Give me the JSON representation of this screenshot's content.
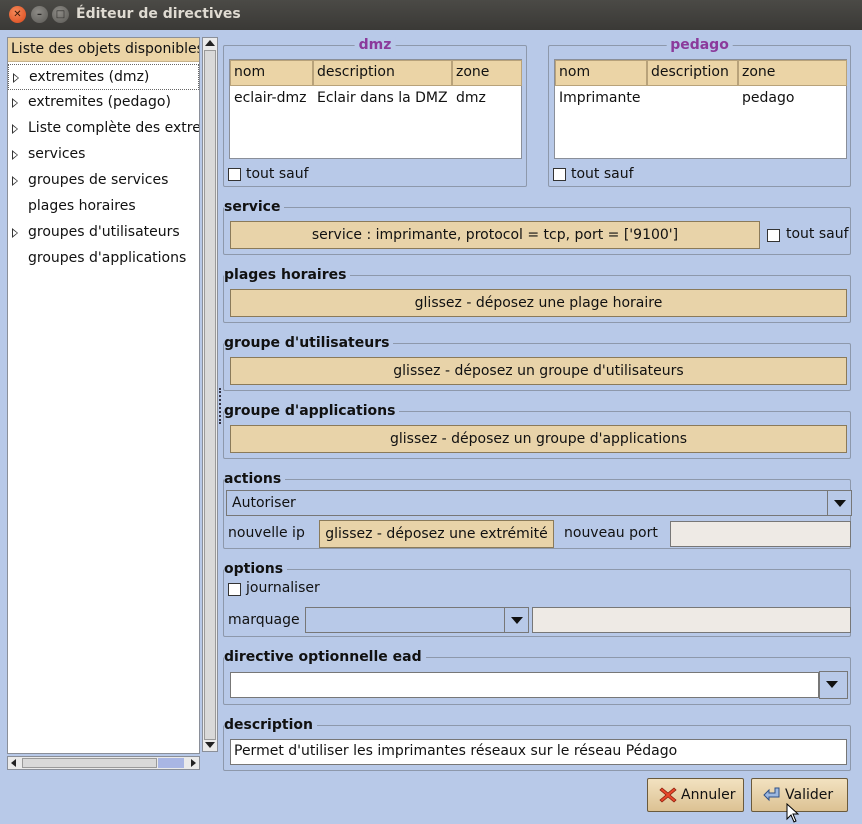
{
  "window": {
    "title": "Éditeur de directives",
    "close_glyph": "✕",
    "min_glyph": "–",
    "max_glyph": "□"
  },
  "left_panel": {
    "header": "Liste des objets disponibles",
    "items": [
      {
        "label": "extremites (dmz)",
        "expandable": true
      },
      {
        "label": "extremites (pedago)",
        "expandable": true
      },
      {
        "label": "Liste complète des extremites",
        "expandable": true
      },
      {
        "label": "services",
        "expandable": true
      },
      {
        "label": "groupes de services",
        "expandable": true
      },
      {
        "label": "plages horaires",
        "expandable": false
      },
      {
        "label": "groupes d'utilisateurs",
        "expandable": true
      },
      {
        "label": "groupes d'applications",
        "expandable": false
      }
    ]
  },
  "source": {
    "title": "dmz",
    "columns": [
      "nom",
      "description",
      "zone"
    ],
    "rows": [
      [
        "eclair-dmz",
        "Eclair dans la DMZ",
        "dmz"
      ]
    ],
    "tout_sauf": "tout sauf"
  },
  "destination": {
    "title": "pedago",
    "columns": [
      "nom",
      "description",
      "zone"
    ],
    "rows": [
      [
        "Imprimante",
        "",
        "pedago"
      ]
    ],
    "tout_sauf": "tout sauf"
  },
  "service": {
    "title": "service",
    "value": "service : imprimante, protocol = tcp, port = ['9100']",
    "tout_sauf": "tout sauf"
  },
  "plages": {
    "title": "plages horaires",
    "drop": "glissez - déposez une plage horaire"
  },
  "groupe_utilisateurs": {
    "title": "groupe d'utilisateurs",
    "drop": "glissez - déposez un groupe d'utilisateurs"
  },
  "groupe_applications": {
    "title": "groupe d'applications",
    "drop": "glissez - déposez un groupe d'applications"
  },
  "actions": {
    "title": "actions",
    "selected": "Autoriser",
    "nouvelle_ip": "nouvelle ip",
    "drop": "glissez - déposez une extrémité",
    "nouveau_port": "nouveau port",
    "nouveau_port_value": ""
  },
  "options": {
    "title": "options",
    "journaliser": "journaliser",
    "marquage": "marquage",
    "marquage_value": "",
    "marquage_entry": ""
  },
  "directive_ead": {
    "title": "directive optionnelle ead",
    "value": ""
  },
  "description": {
    "title": "description",
    "value": "Permet d'utiliser les imprimantes réseaux sur le réseau Pédago"
  },
  "buttons": {
    "cancel": "Annuler",
    "ok": "Valider"
  },
  "colors": {
    "background": "#b8c9e8",
    "header": "#ebd4a6",
    "accent_title": "#8b3a9b"
  }
}
